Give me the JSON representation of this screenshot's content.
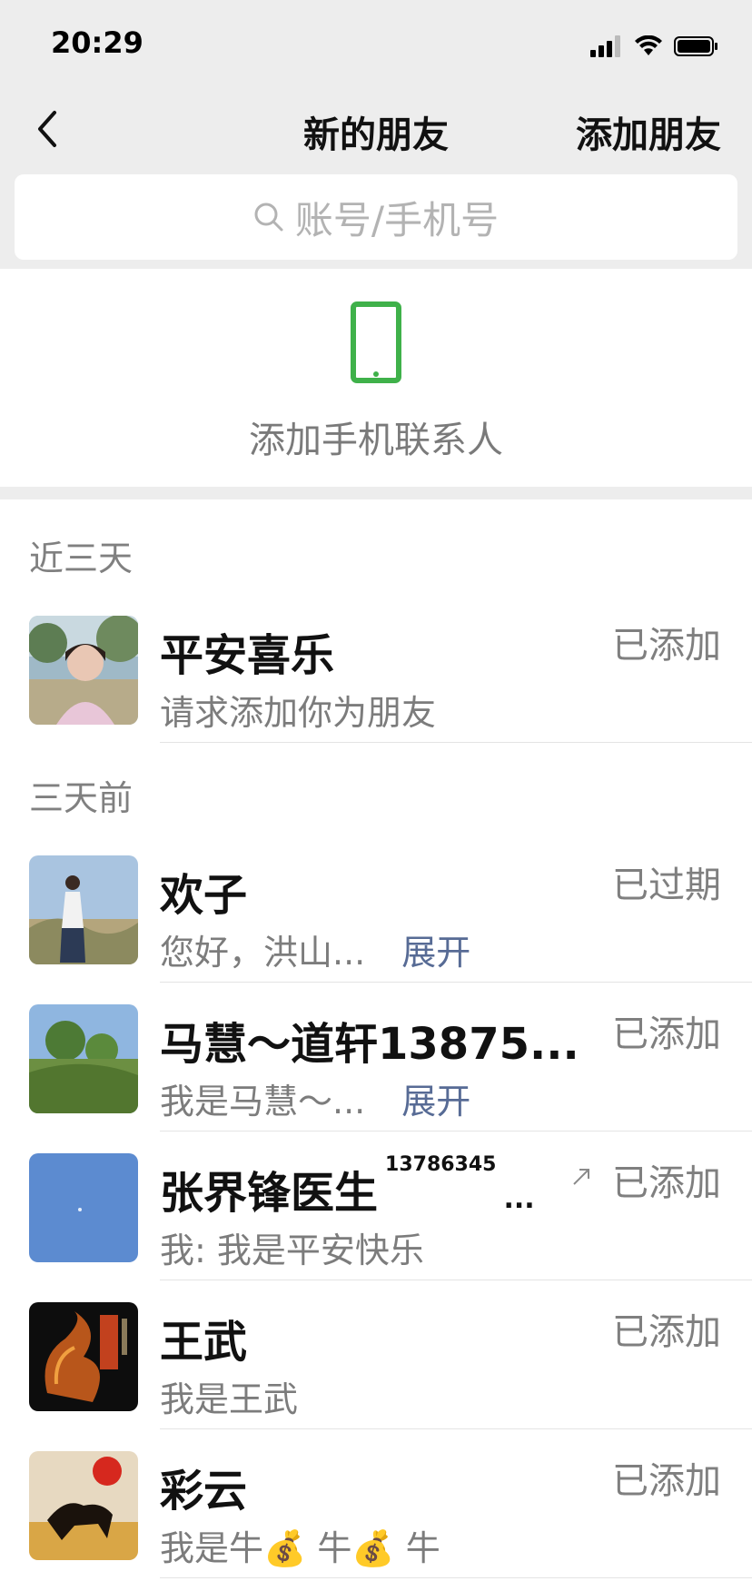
{
  "status_bar": {
    "time": "20:29"
  },
  "nav": {
    "title": "新的朋友",
    "action": "添加朋友"
  },
  "search": {
    "placeholder": "账号/手机号"
  },
  "add_contacts": {
    "label": "添加手机联系人",
    "accent": "#3fb14a"
  },
  "sections": [
    {
      "title": "近三天",
      "rows": [
        {
          "name": "平安喜乐",
          "message": "请求添加你为朋友",
          "expand": "",
          "status": "已添加"
        }
      ]
    },
    {
      "title": "三天前",
      "rows": [
        {
          "name": "欢子",
          "message": "您好，洪山...",
          "expand": "展开",
          "status": "已过期"
        },
        {
          "name": "马慧～道轩13875...",
          "message": "我是马慧～...",
          "expand": "展开",
          "status": "已添加"
        },
        {
          "name": "张界锋医生",
          "name_extra": "13786345",
          "name_ellipsis": "...",
          "message": "我: 我是平安快乐",
          "expand": "",
          "status": "已添加"
        },
        {
          "name": "王武",
          "message": "我是王武",
          "expand": "",
          "status": "已添加"
        },
        {
          "name": "彩云",
          "message": "我是牛💰 牛💰 牛",
          "expand": "",
          "status": "已添加"
        }
      ]
    }
  ],
  "colors": {
    "link": "#576b95",
    "background": "#ededed"
  }
}
